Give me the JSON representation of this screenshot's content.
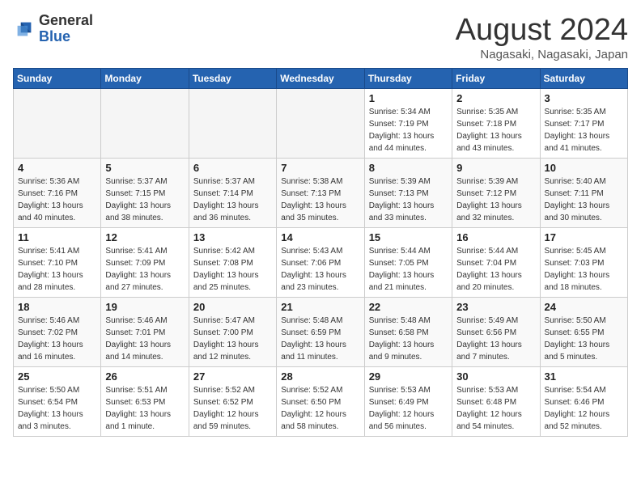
{
  "header": {
    "logo_general": "General",
    "logo_blue": "Blue",
    "month_title": "August 2024",
    "location": "Nagasaki, Nagasaki, Japan"
  },
  "weekdays": [
    "Sunday",
    "Monday",
    "Tuesday",
    "Wednesday",
    "Thursday",
    "Friday",
    "Saturday"
  ],
  "weeks": [
    [
      {
        "day": "",
        "info": ""
      },
      {
        "day": "",
        "info": ""
      },
      {
        "day": "",
        "info": ""
      },
      {
        "day": "",
        "info": ""
      },
      {
        "day": "1",
        "info": "Sunrise: 5:34 AM\nSunset: 7:19 PM\nDaylight: 13 hours\nand 44 minutes."
      },
      {
        "day": "2",
        "info": "Sunrise: 5:35 AM\nSunset: 7:18 PM\nDaylight: 13 hours\nand 43 minutes."
      },
      {
        "day": "3",
        "info": "Sunrise: 5:35 AM\nSunset: 7:17 PM\nDaylight: 13 hours\nand 41 minutes."
      }
    ],
    [
      {
        "day": "4",
        "info": "Sunrise: 5:36 AM\nSunset: 7:16 PM\nDaylight: 13 hours\nand 40 minutes."
      },
      {
        "day": "5",
        "info": "Sunrise: 5:37 AM\nSunset: 7:15 PM\nDaylight: 13 hours\nand 38 minutes."
      },
      {
        "day": "6",
        "info": "Sunrise: 5:37 AM\nSunset: 7:14 PM\nDaylight: 13 hours\nand 36 minutes."
      },
      {
        "day": "7",
        "info": "Sunrise: 5:38 AM\nSunset: 7:13 PM\nDaylight: 13 hours\nand 35 minutes."
      },
      {
        "day": "8",
        "info": "Sunrise: 5:39 AM\nSunset: 7:13 PM\nDaylight: 13 hours\nand 33 minutes."
      },
      {
        "day": "9",
        "info": "Sunrise: 5:39 AM\nSunset: 7:12 PM\nDaylight: 13 hours\nand 32 minutes."
      },
      {
        "day": "10",
        "info": "Sunrise: 5:40 AM\nSunset: 7:11 PM\nDaylight: 13 hours\nand 30 minutes."
      }
    ],
    [
      {
        "day": "11",
        "info": "Sunrise: 5:41 AM\nSunset: 7:10 PM\nDaylight: 13 hours\nand 28 minutes."
      },
      {
        "day": "12",
        "info": "Sunrise: 5:41 AM\nSunset: 7:09 PM\nDaylight: 13 hours\nand 27 minutes."
      },
      {
        "day": "13",
        "info": "Sunrise: 5:42 AM\nSunset: 7:08 PM\nDaylight: 13 hours\nand 25 minutes."
      },
      {
        "day": "14",
        "info": "Sunrise: 5:43 AM\nSunset: 7:06 PM\nDaylight: 13 hours\nand 23 minutes."
      },
      {
        "day": "15",
        "info": "Sunrise: 5:44 AM\nSunset: 7:05 PM\nDaylight: 13 hours\nand 21 minutes."
      },
      {
        "day": "16",
        "info": "Sunrise: 5:44 AM\nSunset: 7:04 PM\nDaylight: 13 hours\nand 20 minutes."
      },
      {
        "day": "17",
        "info": "Sunrise: 5:45 AM\nSunset: 7:03 PM\nDaylight: 13 hours\nand 18 minutes."
      }
    ],
    [
      {
        "day": "18",
        "info": "Sunrise: 5:46 AM\nSunset: 7:02 PM\nDaylight: 13 hours\nand 16 minutes."
      },
      {
        "day": "19",
        "info": "Sunrise: 5:46 AM\nSunset: 7:01 PM\nDaylight: 13 hours\nand 14 minutes."
      },
      {
        "day": "20",
        "info": "Sunrise: 5:47 AM\nSunset: 7:00 PM\nDaylight: 13 hours\nand 12 minutes."
      },
      {
        "day": "21",
        "info": "Sunrise: 5:48 AM\nSunset: 6:59 PM\nDaylight: 13 hours\nand 11 minutes."
      },
      {
        "day": "22",
        "info": "Sunrise: 5:48 AM\nSunset: 6:58 PM\nDaylight: 13 hours\nand 9 minutes."
      },
      {
        "day": "23",
        "info": "Sunrise: 5:49 AM\nSunset: 6:56 PM\nDaylight: 13 hours\nand 7 minutes."
      },
      {
        "day": "24",
        "info": "Sunrise: 5:50 AM\nSunset: 6:55 PM\nDaylight: 13 hours\nand 5 minutes."
      }
    ],
    [
      {
        "day": "25",
        "info": "Sunrise: 5:50 AM\nSunset: 6:54 PM\nDaylight: 13 hours\nand 3 minutes."
      },
      {
        "day": "26",
        "info": "Sunrise: 5:51 AM\nSunset: 6:53 PM\nDaylight: 13 hours\nand 1 minute."
      },
      {
        "day": "27",
        "info": "Sunrise: 5:52 AM\nSunset: 6:52 PM\nDaylight: 12 hours\nand 59 minutes."
      },
      {
        "day": "28",
        "info": "Sunrise: 5:52 AM\nSunset: 6:50 PM\nDaylight: 12 hours\nand 58 minutes."
      },
      {
        "day": "29",
        "info": "Sunrise: 5:53 AM\nSunset: 6:49 PM\nDaylight: 12 hours\nand 56 minutes."
      },
      {
        "day": "30",
        "info": "Sunrise: 5:53 AM\nSunset: 6:48 PM\nDaylight: 12 hours\nand 54 minutes."
      },
      {
        "day": "31",
        "info": "Sunrise: 5:54 AM\nSunset: 6:46 PM\nDaylight: 12 hours\nand 52 minutes."
      }
    ]
  ]
}
